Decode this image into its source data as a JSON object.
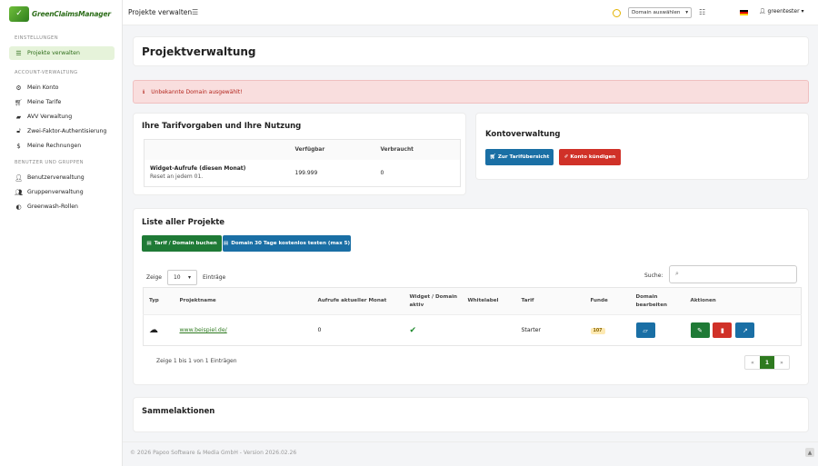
{
  "brand": {
    "logo_text": "GreenClaimsManager"
  },
  "sidebar": {
    "sections": [
      {
        "title": "EINSTELLUNGEN",
        "items": [
          {
            "label": "Projekte verwalten",
            "icon": "list-icon",
            "active": true
          }
        ]
      },
      {
        "title": "ACCOUNT-VERWALTUNG",
        "items": [
          {
            "label": "Mein Konto",
            "icon": "gear-icon"
          },
          {
            "label": "Meine Tarife",
            "icon": "cart-icon"
          },
          {
            "label": "AVV Verwaltung",
            "icon": "book-icon"
          },
          {
            "label": "Zwei-Faktor-Authentisierung",
            "icon": "unlock-icon"
          },
          {
            "label": "Meine Rechnungen",
            "icon": "dollar-icon"
          }
        ]
      },
      {
        "title": "BENUTZER UND GRUPPEN",
        "items": [
          {
            "label": "Benutzerverwaltung",
            "icon": "user-icon"
          },
          {
            "label": "Gruppenverwaltung",
            "icon": "users-icon"
          },
          {
            "label": "Greenwash-Rollen",
            "icon": "shield-icon"
          }
        ]
      }
    ]
  },
  "topbar": {
    "title": "Projekte verwalten",
    "domain_select": "Domain auswählen",
    "user": "greentester"
  },
  "page": {
    "title": "Projektverwaltung"
  },
  "alert": {
    "text": "Unbekannte Domain ausgewählt!"
  },
  "limits": {
    "title": "Ihre Tarifvorgaben und Ihre Nutzung",
    "col_available": "Verfügbar",
    "col_used": "Verbraucht",
    "row_label": "Widget-Aufrufe (diesen Monat)",
    "row_sub": "Reset an jedem 01.",
    "available": "199.999",
    "used": "0"
  },
  "account": {
    "title": "Kontoverwaltung",
    "btn_overview": "Zur Tarifübersicht",
    "btn_cancel": "Konto kündigen"
  },
  "projects": {
    "title": "Liste aller Projekte",
    "btn_book": "Tarif / Domain buchen",
    "btn_trial": "Domain 30 Tage kostenlos testen (max 5)",
    "show_label": "Zeige",
    "show_value": "10",
    "entries_label": "Einträge",
    "search_label": "Suche:",
    "columns": [
      "Typ",
      "Projektname",
      "Aufrufe aktueller Monat",
      "Widget / Domain aktiv",
      "Whitelabel",
      "Tarif",
      "Funde",
      "Domain bearbeiten",
      "Aktionen"
    ],
    "rows": [
      {
        "name": "www.beispiel.de/",
        "calls": "0",
        "tariff": "Starter",
        "finds": "107"
      }
    ],
    "info": "Zeige 1 bis 1 von 1 Einträgen",
    "pager": {
      "prev": "«",
      "page": "1",
      "next": "»"
    }
  },
  "bulk": {
    "title": "Sammelaktionen"
  },
  "footer": {
    "text": "© 2026 Papoo Software & Media GmbH - Version 2026.02.26"
  }
}
